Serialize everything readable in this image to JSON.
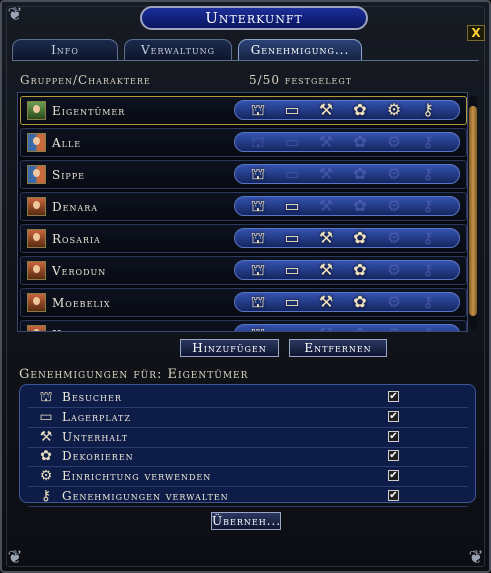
{
  "window": {
    "title": "Unterkunft",
    "close_label": "X"
  },
  "tabs": [
    {
      "label": "Info",
      "active": false
    },
    {
      "label": "Verwaltung",
      "active": false
    },
    {
      "label": "Genehmigung...",
      "active": true
    }
  ],
  "list_header": {
    "groups_label": "Gruppen/Charaktere",
    "count_label": "5/50 festgelegt"
  },
  "permission_icon_names": [
    "chest-visitor-icon",
    "storage-chest-icon",
    "tools-icon",
    "flower-vase-icon",
    "gears-icon",
    "key-icon"
  ],
  "rows": [
    {
      "name": "Eigentümer",
      "avatar": "green",
      "selected": true,
      "permissions": [
        true,
        true,
        true,
        true,
        true,
        true
      ]
    },
    {
      "name": "Alle",
      "avatar": "multi",
      "selected": false,
      "permissions": [
        false,
        false,
        false,
        false,
        false,
        false
      ]
    },
    {
      "name": "Sippe",
      "avatar": "multi",
      "selected": false,
      "permissions": [
        true,
        false,
        false,
        false,
        false,
        false
      ]
    },
    {
      "name": "Denara",
      "avatar": "orange",
      "selected": false,
      "permissions": [
        true,
        true,
        false,
        false,
        false,
        false
      ]
    },
    {
      "name": "Rosaria",
      "avatar": "orange",
      "selected": false,
      "permissions": [
        true,
        true,
        true,
        true,
        false,
        false
      ]
    },
    {
      "name": "Verodun",
      "avatar": "orange",
      "selected": false,
      "permissions": [
        true,
        true,
        true,
        true,
        false,
        false
      ]
    },
    {
      "name": "Moebelix",
      "avatar": "orange",
      "selected": false,
      "permissions": [
        true,
        true,
        true,
        true,
        false,
        false
      ]
    },
    {
      "name": "Kuuu...",
      "avatar": "orange",
      "selected": false,
      "permissions": [
        true,
        false,
        false,
        false,
        false,
        false
      ]
    }
  ],
  "buttons": {
    "add": "Hinzufügen",
    "remove": "Entfernen",
    "apply": "Überneh..."
  },
  "permissions_section": {
    "title": "Genehmigungen für: Eigentümer",
    "items": [
      {
        "label": "Besucher",
        "icon": "chest-visitor-icon",
        "checked": true
      },
      {
        "label": "Lagerplatz",
        "icon": "storage-chest-icon",
        "checked": true
      },
      {
        "label": "Unterhalt",
        "icon": "tools-icon",
        "checked": true
      },
      {
        "label": "Dekorieren",
        "icon": "flower-vase-icon",
        "checked": true
      },
      {
        "label": "Einrichtung verwenden",
        "icon": "gears-icon",
        "checked": true
      },
      {
        "label": "Genehmigungen verwalten",
        "icon": "key-icon",
        "checked": true
      }
    ]
  },
  "colors": {
    "accent_gold": "#b59a3c",
    "bar_blue": "#3452b0",
    "panel_blue": "#0d1d48"
  }
}
